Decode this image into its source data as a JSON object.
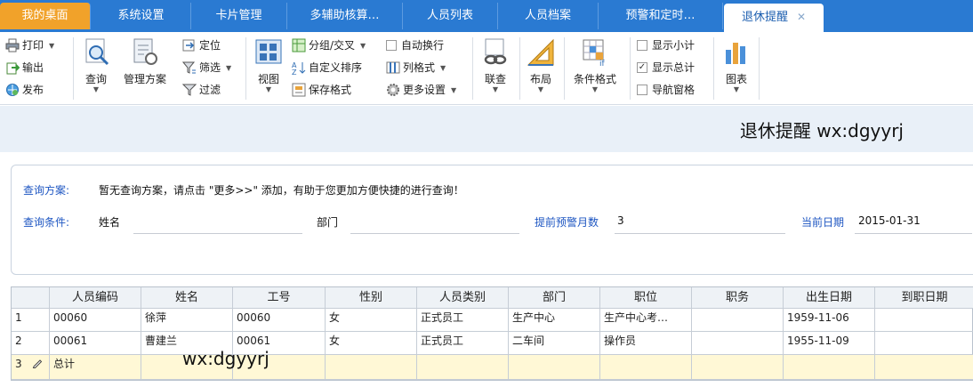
{
  "tabs": [
    {
      "label": "我的桌面"
    },
    {
      "label": "系统设置"
    },
    {
      "label": "卡片管理"
    },
    {
      "label": "多辅助核算…"
    },
    {
      "label": "人员列表"
    },
    {
      "label": "人员档案"
    },
    {
      "label": "预警和定时…"
    },
    {
      "label": "退休提醒",
      "close": "✕"
    }
  ],
  "ribbon": {
    "print": "打印",
    "export": "输出",
    "publish": "发布",
    "query": "查询",
    "manage_scheme": "管理方案",
    "locate": "定位",
    "filter": "筛选",
    "filter2": "过滤",
    "view": "视图",
    "group_cross": "分组/交叉",
    "custom_sort": "自定义排序",
    "save_format": "保存格式",
    "auto_wrap": "自动换行",
    "column_format": "列格式",
    "more_settings": "更多设置",
    "link_query": "联查",
    "layout": "布局",
    "cond_format": "条件格式",
    "show_subtotal": "显示小计",
    "show_total": "显示总计",
    "nav_pane": "导航窗格",
    "chart": "图表"
  },
  "title": "退休提醒 wx:dgyyrj",
  "query": {
    "scheme_label": "查询方案:",
    "scheme_hint": "暂无查询方案，请点击 \"更多>>\" 添加，有助于您更加方便快捷的进行查询！",
    "cond_label": "查询条件:",
    "name_label": "姓名",
    "name_value": "",
    "dept_label": "部门",
    "dept_value": "",
    "months_label": "提前预警月数",
    "months_value": "3",
    "date_label": "当前日期",
    "date_value": "2015-01-31"
  },
  "grid": {
    "headers": [
      "",
      "人员编码",
      "姓名",
      "工号",
      "性别",
      "人员类别",
      "部门",
      "职位",
      "职务",
      "出生日期",
      "到职日期"
    ],
    "rows": [
      [
        "1",
        "00060",
        "徐萍",
        "00060",
        "女",
        "正式员工",
        "生产中心",
        "生产中心考…",
        "",
        "1959-11-06",
        ""
      ],
      [
        "2",
        "00061",
        "曹建兰",
        "00061",
        "女",
        "正式员工",
        "二车间",
        "操作员",
        "",
        "1955-11-09",
        ""
      ]
    ],
    "total_row_num": "3",
    "total_label": "总计"
  },
  "watermark": "wx:dgyyrj",
  "colors": {
    "tabbar": "#2a7ad2",
    "home_tab": "#f1a22a",
    "link_blue": "#1e56c2",
    "total_row": "#fff8d6"
  }
}
